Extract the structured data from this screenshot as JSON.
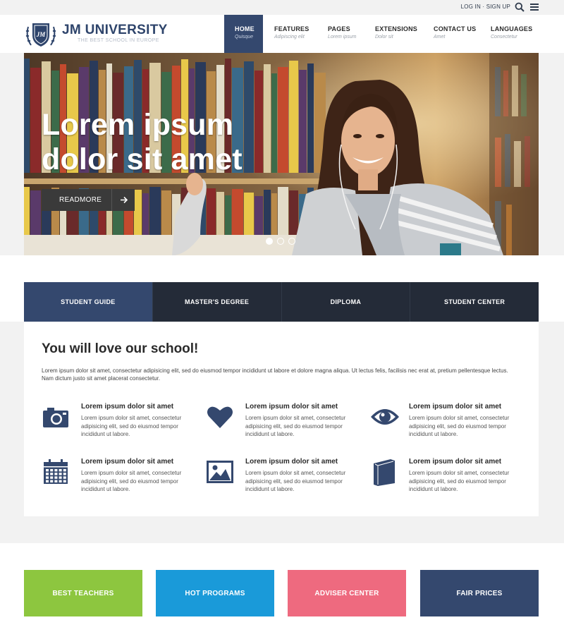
{
  "topbar": {
    "login": "LOG IN",
    "separator": "·",
    "signup": "SIGN UP",
    "search_icon": "search-icon",
    "menu_icon": "hamburger-icon"
  },
  "brand": {
    "name": "JM UNIVERSITY",
    "tagline": "THE BEST SCHOOL IN EUROPE",
    "crest_text": "JM",
    "color": "#2e446b"
  },
  "nav": [
    {
      "label": "HOME",
      "sub": "Quisque",
      "active": true
    },
    {
      "label": "FEATURES",
      "sub": "Adipiscing elit"
    },
    {
      "label": "PAGES",
      "sub": "Lorem ipsum"
    },
    {
      "label": "EXTENSIONS",
      "sub": "Dolor sit"
    },
    {
      "label": "CONTACT US",
      "sub": "Amet"
    },
    {
      "label": "LANGUAGES",
      "sub": "Consectetur"
    }
  ],
  "hero": {
    "title_line1": "Lorem ipsum",
    "title_line2": "dolor sit amet",
    "button": "READMORE",
    "slides": 3,
    "active_slide": 1
  },
  "tabs": [
    {
      "label": "STUDENT GUIDE",
      "active": true
    },
    {
      "label": "MASTER'S DEGREE"
    },
    {
      "label": "DIPLOMA"
    },
    {
      "label": "STUDENT CENTER"
    }
  ],
  "section": {
    "title": "You will love our school!",
    "intro": "Lorem ipsum dolor sit amet, consectetur adipisicing elit, sed do eiusmod tempor incididunt ut labore et dolore magna aliqua. Ut lectus felis, facilisis nec erat at, pretium pellentesque lectus. Nam dictum justo sit amet placerat consectetur."
  },
  "features": [
    {
      "icon": "camera-icon",
      "title": "Lorem ipsum dolor sit amet",
      "text": "Lorem ipsum dolor sit amet, consectetur adipisicing elit, sed do eiusmod tempor incididunt ut labore."
    },
    {
      "icon": "heart-icon",
      "title": "Lorem ipsum dolor sit amet",
      "text": "Lorem ipsum dolor sit amet, consectetur adipisicing elit, sed do eiusmod tempor incididunt ut labore."
    },
    {
      "icon": "eye-icon",
      "title": "Lorem ipsum dolor sit amet",
      "text": "Lorem ipsum dolor sit amet, consectetur adipisicing elit, sed do eiusmod tempor incididunt ut labore."
    },
    {
      "icon": "calendar-icon",
      "title": "Lorem ipsum dolor sit amet",
      "text": "Lorem ipsum dolor sit amet, consectetur adipisicing elit, sed do eiusmod tempor incididunt ut labore."
    },
    {
      "icon": "image-icon",
      "title": "Lorem ipsum dolor sit amet",
      "text": "Lorem ipsum dolor sit amet, consectetur adipisicing elit, sed do eiusmod tempor incididunt ut labore."
    },
    {
      "icon": "book-icon",
      "title": "Lorem ipsum dolor sit amet",
      "text": "Lorem ipsum dolor sit amet, consectetur adipisicing elit, sed do eiusmod tempor incididunt ut labore."
    }
  ],
  "ctas": [
    {
      "label": "BEST TEACHERS",
      "color": "#8dc63f"
    },
    {
      "label": "HOT PROGRAMS",
      "color": "#1a9ad9"
    },
    {
      "label": "ADVISER CENTER",
      "color": "#ee6a7f"
    },
    {
      "label": "FAIR PRICES",
      "color": "#34486e"
    }
  ],
  "colors": {
    "primary": "#34486e",
    "dark": "#242b38",
    "icon": "#34486e"
  }
}
